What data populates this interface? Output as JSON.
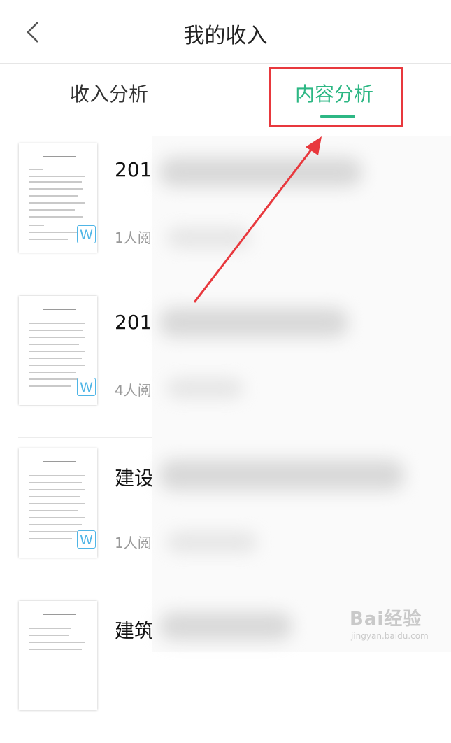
{
  "header": {
    "title": "我的收入"
  },
  "tabs": [
    {
      "label": "收入分析",
      "active": false
    },
    {
      "label": "内容分析",
      "active": true
    }
  ],
  "accent_color": "#2db784",
  "highlight_color": "#e8383d",
  "items": [
    {
      "title": "2019",
      "reads": "1人阅",
      "badge": "W"
    },
    {
      "title": "2019",
      "reads": "4人阅",
      "badge": "W"
    },
    {
      "title": "建设",
      "reads": "1人阅",
      "badge": "W"
    },
    {
      "title": "建筑",
      "reads": "",
      "badge": ""
    }
  ],
  "watermark": {
    "brand": "Bai经验",
    "url": "jingyan.baidu.com"
  }
}
